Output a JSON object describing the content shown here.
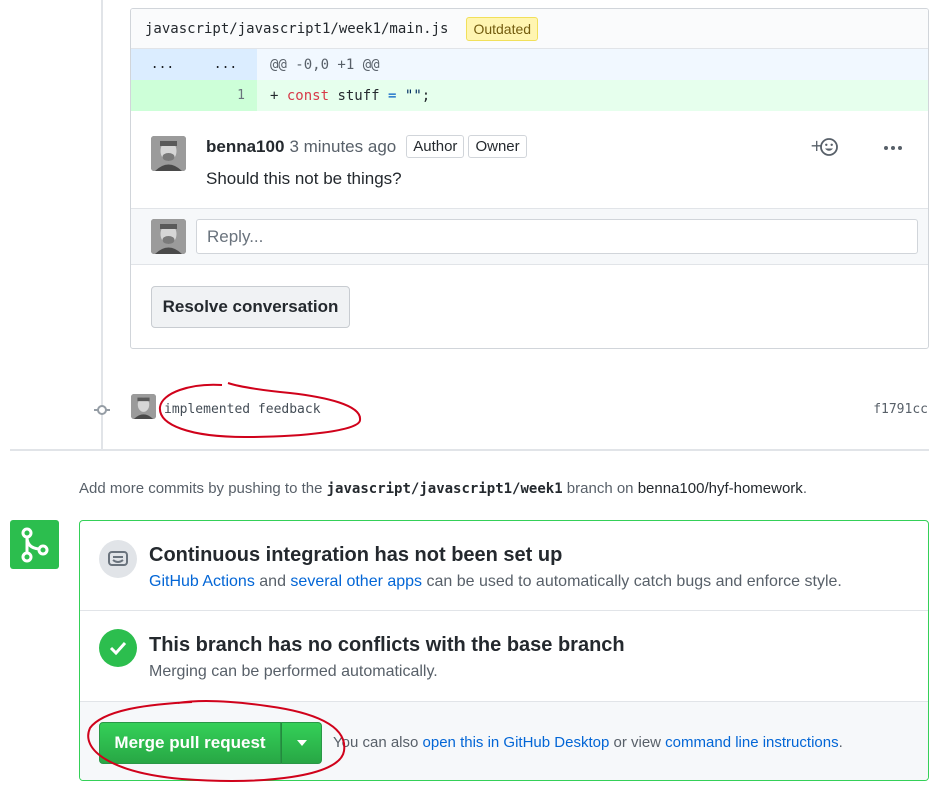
{
  "thread": {
    "file_path": "javascript/javascript1/week1/main.js",
    "badge": "Outdated",
    "hunk": {
      "old_num": "...",
      "new_num": "...",
      "code": "@@ -0,0 +1 @@"
    },
    "added_line": {
      "new_num": "1",
      "prefix": "+ ",
      "keyword": "const",
      "ident": " stuff ",
      "operator": "=",
      "space": " ",
      "string": "\"\"",
      "terminator": ";"
    },
    "comment": {
      "author": "benna100",
      "time": "3 minutes ago",
      "labels": [
        "Author",
        "Owner"
      ],
      "body": "Should this not be things?",
      "reaction_icon": "smiley-icon",
      "more_icon": "kebab-horizontal-icon"
    },
    "reply_placeholder": "Reply...",
    "resolve_label": "Resolve conversation"
  },
  "commit": {
    "message": "implemented feedback",
    "sha": "f1791cc"
  },
  "push_hint": {
    "prefix": "Add more commits by pushing to the ",
    "branch": "javascript/javascript1/week1",
    "middle": " branch on ",
    "repo": "benna100/hyf-homework",
    "suffix": "."
  },
  "merge_box": {
    "ci": {
      "title": "Continuous integration has not been set up",
      "link1": "GitHub Actions",
      "text1": " and ",
      "link2": "several other apps",
      "text2": " can be used to automatically catch bugs and enforce style."
    },
    "conflicts": {
      "title": "This branch has no conflicts with the base branch",
      "sub": "Merging can be performed automatically."
    },
    "merge": {
      "button_label": "Merge pull request",
      "alt_prefix": "You can also ",
      "alt_link1": "open this in GitHub Desktop",
      "alt_mid": " or view ",
      "alt_link2": "command line instructions",
      "alt_suffix": "."
    }
  },
  "colors": {
    "accent_green": "#2cbe4e",
    "link_blue": "#0366d6",
    "annotation_red": "#d0021b",
    "outdated_bg": "#fff5b1"
  }
}
